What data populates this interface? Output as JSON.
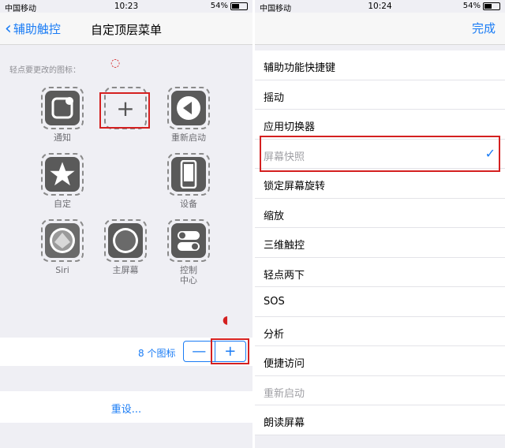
{
  "left": {
    "status": {
      "carrier": "中国移动",
      "time": "10:23",
      "battery": "54%"
    },
    "nav": {
      "back_label": "辅助触控",
      "title": "自定顶层菜单"
    },
    "hint": "轻点要更改的图标：",
    "tiles": [
      {
        "label": "通知",
        "icon": "notification-icon"
      },
      {
        "label": "",
        "icon": "add-icon",
        "glyph": "+"
      },
      {
        "label": "重新启动",
        "icon": "restart-icon"
      },
      {
        "label": "自定",
        "icon": "star-icon"
      },
      {
        "label": "设备",
        "icon": "device-icon"
      },
      {
        "label": "Siri",
        "icon": "siri-icon"
      },
      {
        "label": "主屏幕",
        "icon": "home-icon"
      },
      {
        "label": "控制\n中心",
        "icon": "control-center-icon"
      }
    ],
    "icon_count": "8 个图标",
    "stepper": {
      "minus": "—",
      "plus": "+"
    },
    "reset": "重设..."
  },
  "right": {
    "status": {
      "carrier": "中国移动",
      "time": "10:24",
      "battery": "54%"
    },
    "nav": {
      "done": "完成"
    },
    "items": [
      {
        "label": "辅助功能快捷键",
        "dim": false
      },
      {
        "label": "摇动",
        "dim": false
      },
      {
        "label": "应用切换器",
        "dim": false
      },
      {
        "label": "屏幕快照",
        "dim": true,
        "checked": true
      },
      {
        "label": "锁定屏幕旋转",
        "dim": false
      },
      {
        "label": "缩放",
        "dim": false
      },
      {
        "label": "三维触控",
        "dim": false
      },
      {
        "label": "轻点两下",
        "dim": false
      },
      {
        "label": "SOS",
        "dim": false
      },
      {
        "label": "分析",
        "dim": false
      },
      {
        "label": "便捷访问",
        "dim": false
      },
      {
        "label": "重新启动",
        "dim": true
      },
      {
        "label": "朗读屏幕",
        "dim": false
      }
    ],
    "check_glyph": "✓"
  },
  "colors": {
    "accent": "#1a7cf5",
    "highlight": "#d42020"
  }
}
